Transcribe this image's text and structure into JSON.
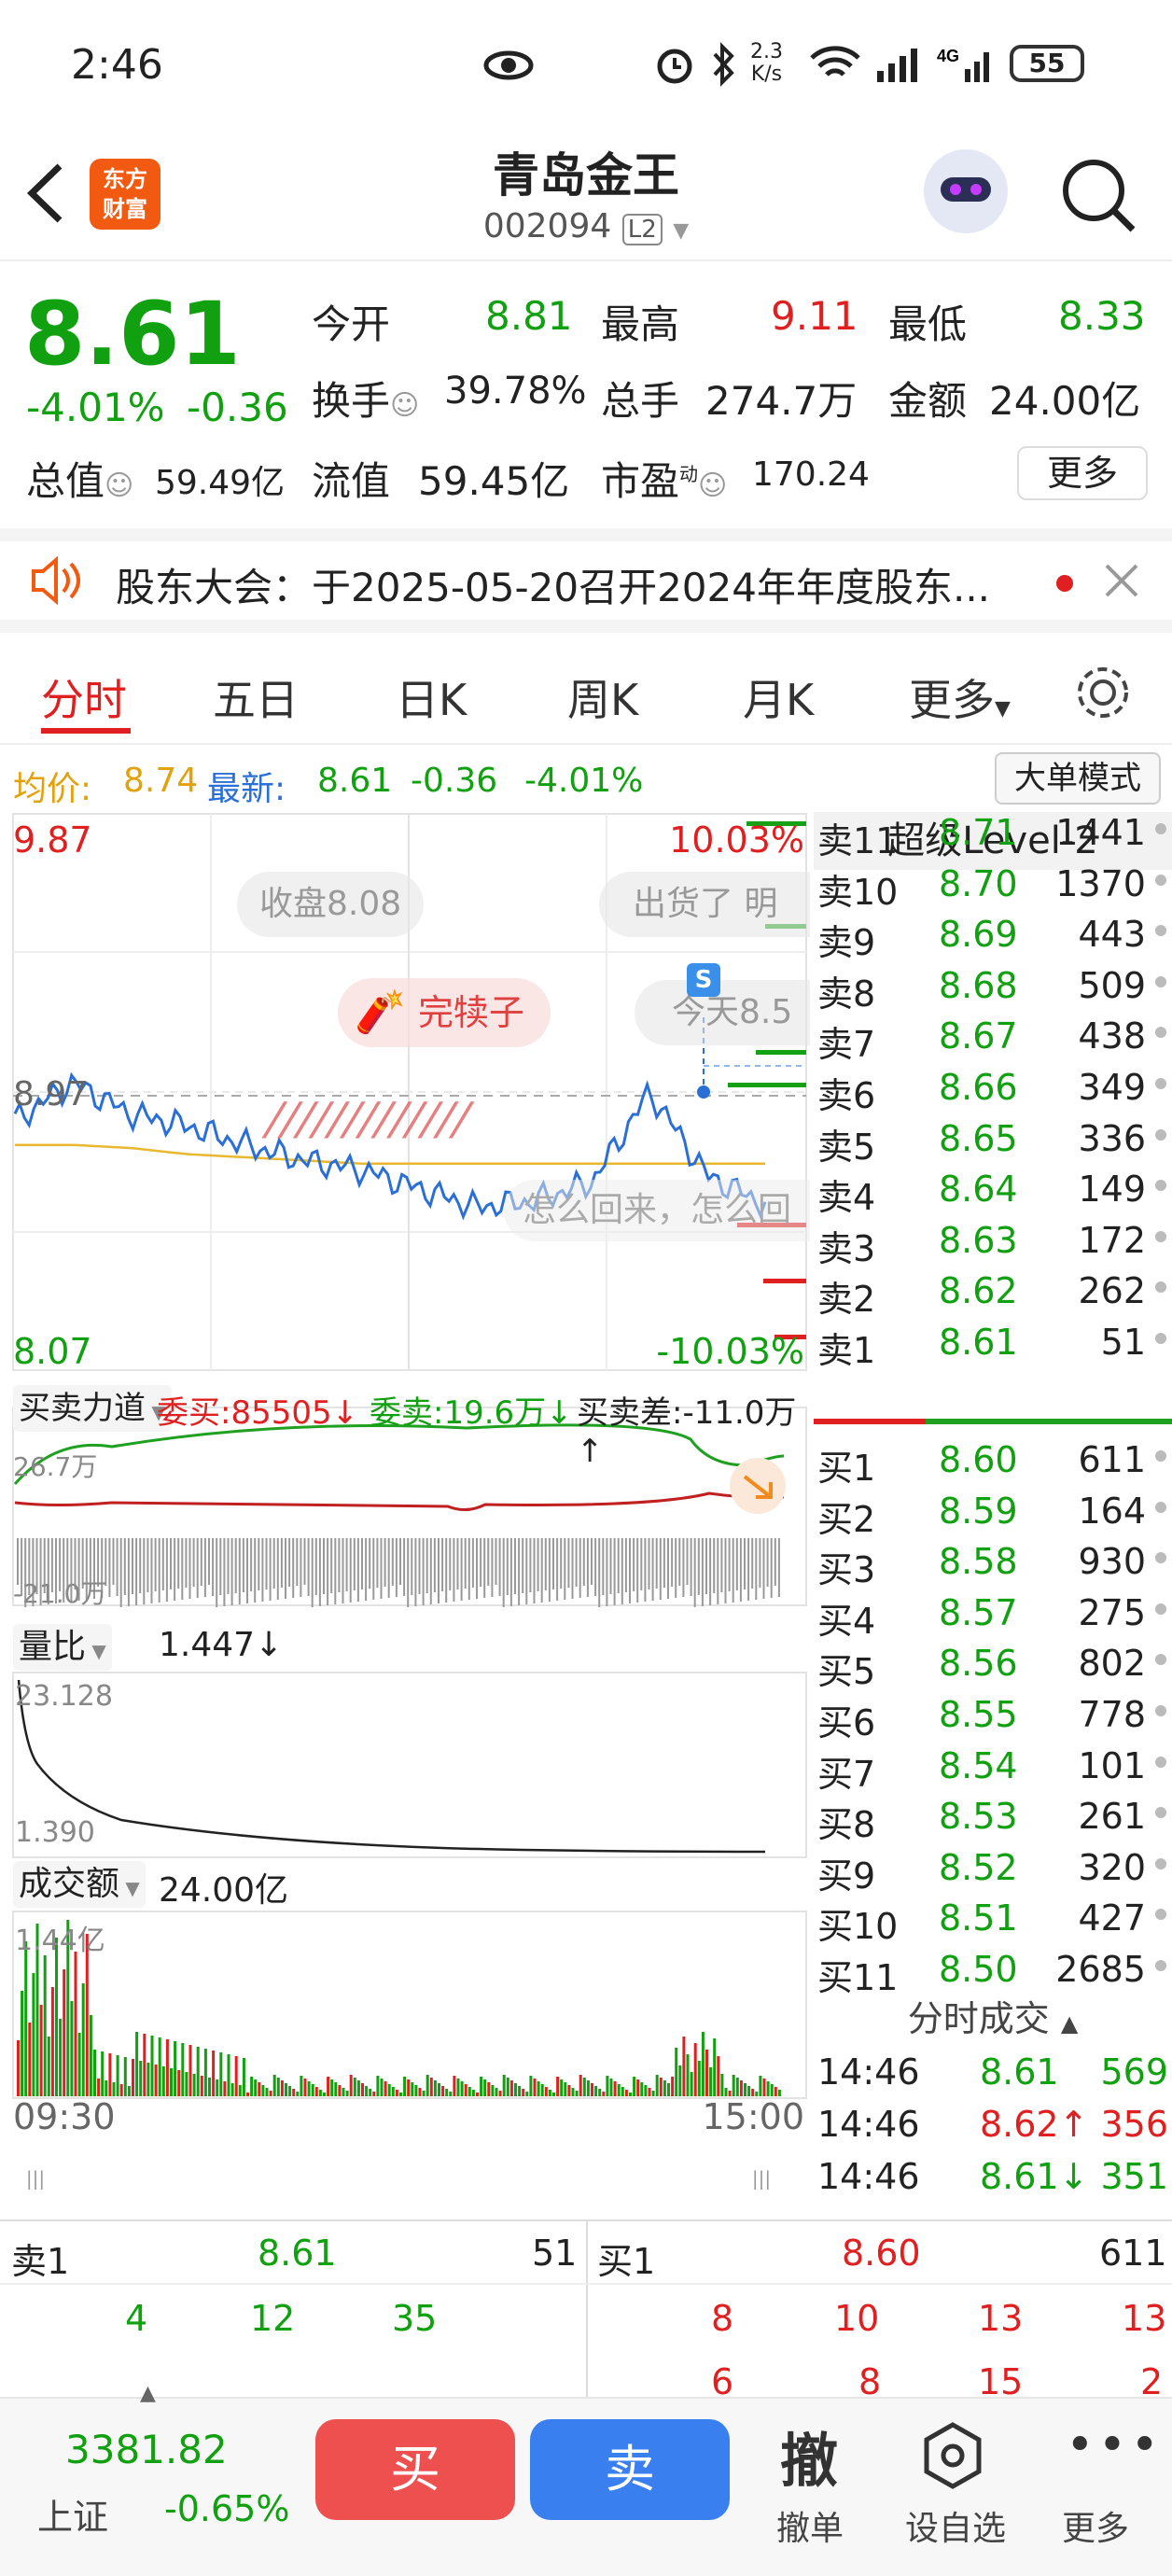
{
  "status": {
    "time": "2:46",
    "speed_value": "2.3",
    "speed_unit": "K/s",
    "battery": "55"
  },
  "header": {
    "title": "青岛金王",
    "code": "002094",
    "level_badge": "L2",
    "logo_text_1": "东方",
    "logo_text_2": "财富"
  },
  "quote": {
    "price": "8.61",
    "change_pct": "-4.01%",
    "change": "-0.36",
    "open_label": "今开",
    "open": "8.81",
    "high_label": "最高",
    "high": "9.11",
    "low_label": "最低",
    "low": "8.33",
    "turnover_label": "换手",
    "turnover": "39.78%",
    "volume_label": "总手",
    "volume": "274.7万",
    "amount_label": "金额",
    "amount": "24.00亿",
    "mktcap_label": "总值",
    "mktcap": "59.49亿",
    "float_label": "流值",
    "float": "59.45亿",
    "pe_label": "市盈",
    "pe_sup": "动",
    "pe": "170.24",
    "more_btn": "更多"
  },
  "notice": {
    "text": "股东大会：于2025-05-20召开2024年年度股东..."
  },
  "tabs": [
    "分时",
    "五日",
    "日K",
    "周K",
    "月K",
    "更多"
  ],
  "avgline": {
    "avg_label": "均价:",
    "avg": "8.74",
    "latest_label": "最新:",
    "latest": "8.61",
    "chg": "-0.36",
    "pct": "-4.01%",
    "mode_btn": "大单模式"
  },
  "chart": {
    "y_max": "9.87",
    "y_min": "8.07",
    "pct_max": "10.03%",
    "pct_min": "-10.03%",
    "ref_price": "8.97",
    "bubble1": "收盘8.08",
    "bubble2": "出货了 明",
    "bubble3": "完犊子",
    "bubble4": "今天8.5",
    "bubble5": "怎么回来，怎么回",
    "flow_label": "买卖力道",
    "flow_buy": "委买:85505↓",
    "flow_sell": "委卖:19.6万↓",
    "flow_diff": "买卖差:-11.0万↑",
    "flow_top": "26.7万",
    "flow_bot": "-21.0万",
    "vr_label": "量比",
    "vr": "1.447↓",
    "vr_top": "23.128",
    "vr_bot": "1.390",
    "amt_label": "成交额",
    "amt": "24.00亿",
    "amt_top": "1.44亿",
    "t_start": "09:30",
    "t_end": "15:00"
  },
  "chart_data": {
    "type": "line",
    "x": [
      "09:30",
      "15:00"
    ],
    "series": [
      {
        "name": "最新",
        "values": [
          8.88,
          9.0,
          8.9,
          8.86,
          8.8,
          8.75,
          8.72,
          8.66,
          8.6,
          8.62,
          8.68,
          8.97,
          8.7,
          8.61
        ]
      },
      {
        "name": "均价",
        "values": [
          8.8,
          8.8,
          8.79,
          8.77,
          8.76,
          8.75,
          8.74,
          8.74,
          8.74,
          8.74,
          8.74,
          8.74,
          8.74,
          8.74
        ]
      }
    ],
    "ylim": [
      8.07,
      9.87
    ]
  },
  "book": {
    "title": "超级Level-2",
    "asks": [
      {
        "l": "卖11",
        "p": "8.71",
        "v": "1441"
      },
      {
        "l": "卖10",
        "p": "8.70",
        "v": "1370"
      },
      {
        "l": "卖9",
        "p": "8.69",
        "v": "443"
      },
      {
        "l": "卖8",
        "p": "8.68",
        "v": "509"
      },
      {
        "l": "卖7",
        "p": "8.67",
        "v": "438"
      },
      {
        "l": "卖6",
        "p": "8.66",
        "v": "349"
      },
      {
        "l": "卖5",
        "p": "8.65",
        "v": "336"
      },
      {
        "l": "卖4",
        "p": "8.64",
        "v": "149"
      },
      {
        "l": "卖3",
        "p": "8.63",
        "v": "172"
      },
      {
        "l": "卖2",
        "p": "8.62",
        "v": "262"
      },
      {
        "l": "卖1",
        "p": "8.61",
        "v": "51"
      }
    ],
    "bids": [
      {
        "l": "买1",
        "p": "8.60",
        "v": "611"
      },
      {
        "l": "买2",
        "p": "8.59",
        "v": "164"
      },
      {
        "l": "买3",
        "p": "8.58",
        "v": "930"
      },
      {
        "l": "买4",
        "p": "8.57",
        "v": "275"
      },
      {
        "l": "买5",
        "p": "8.56",
        "v": "802"
      },
      {
        "l": "买6",
        "p": "8.55",
        "v": "778"
      },
      {
        "l": "买7",
        "p": "8.54",
        "v": "101"
      },
      {
        "l": "买8",
        "p": "8.53",
        "v": "261"
      },
      {
        "l": "买9",
        "p": "8.52",
        "v": "320"
      },
      {
        "l": "买10",
        "p": "8.51",
        "v": "427"
      },
      {
        "l": "买11",
        "p": "8.50",
        "v": "2685"
      }
    ],
    "ticks_title": "分时成交",
    "ticks": [
      {
        "t": "14:46",
        "p": "8.61",
        "v": "569"
      },
      {
        "t": "14:46",
        "p": "8.62↑",
        "v": "356"
      },
      {
        "t": "14:46",
        "p": "8.61↓",
        "v": "351"
      }
    ]
  },
  "bottomq": {
    "sell_label": "卖1",
    "sell_price": "8.61",
    "sell_vol": "51",
    "buy_label": "买1",
    "buy_price": "8.60",
    "buy_vol": "611",
    "sell_q": [
      "4",
      "12",
      "35"
    ],
    "buy_q1": [
      "8",
      "10",
      "13",
      "13"
    ],
    "buy_q2": [
      "6",
      "8",
      "15",
      "2"
    ]
  },
  "footer": {
    "index_val": "3381.82",
    "index_name": "上证",
    "index_pct": "-0.65%",
    "buy": "买",
    "sell": "卖",
    "cancel_icon": "撤",
    "cancel": "撤单",
    "watch": "设自选",
    "more": "更多"
  }
}
